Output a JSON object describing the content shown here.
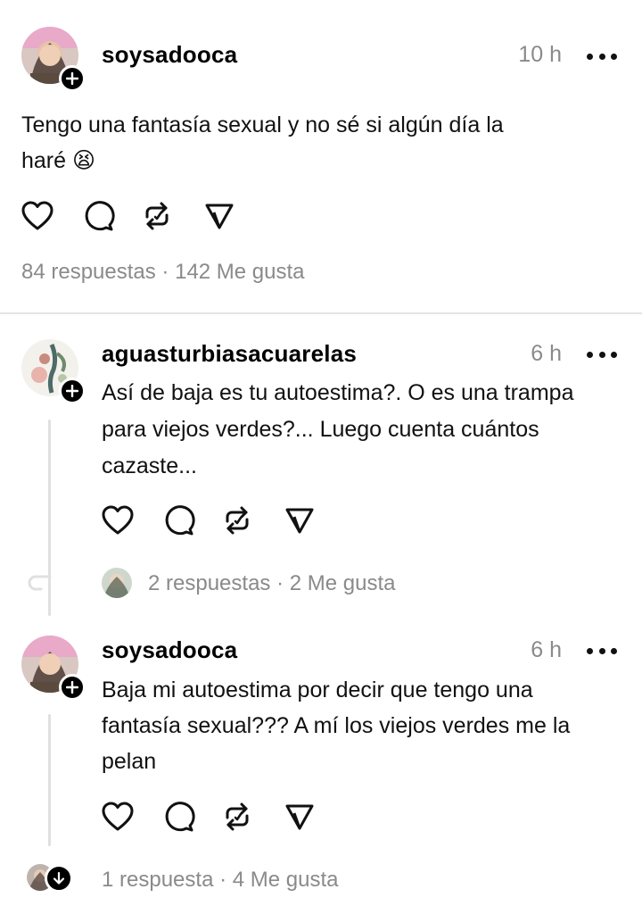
{
  "post": {
    "username": "soysadooca",
    "time": "10 h",
    "text_line1": "Tengo una fantasía sexual y no sé si algún día la",
    "text_line2": "haré 😫",
    "stats": "84 respuestas · 142 Me gusta"
  },
  "replies": [
    {
      "username": "aguasturbiasacuarelas",
      "time": "6 h",
      "lines": [
        "Así de baja es tu autoestima?. O es una trampa",
        "para viejos verdes?... Luego cuenta cuántos",
        "cazaste..."
      ],
      "stats": "2 respuestas · 2 Me gusta"
    },
    {
      "username": "soysadooca",
      "time": "6 h",
      "lines": [
        "Baja mi autoestima por decir que tengo una",
        "fantasía sexual??? A mí los viejos verdes me la",
        "pelan"
      ],
      "stats": "1 respuesta · 4 Me gusta"
    }
  ],
  "icons": [
    "heart-icon",
    "comment-icon",
    "repost-icon",
    "send-icon",
    "more-icon",
    "plus-icon"
  ],
  "colors": {
    "text": "#111111",
    "muted": "#8a8a8a",
    "divider": "#e4e4e4"
  }
}
